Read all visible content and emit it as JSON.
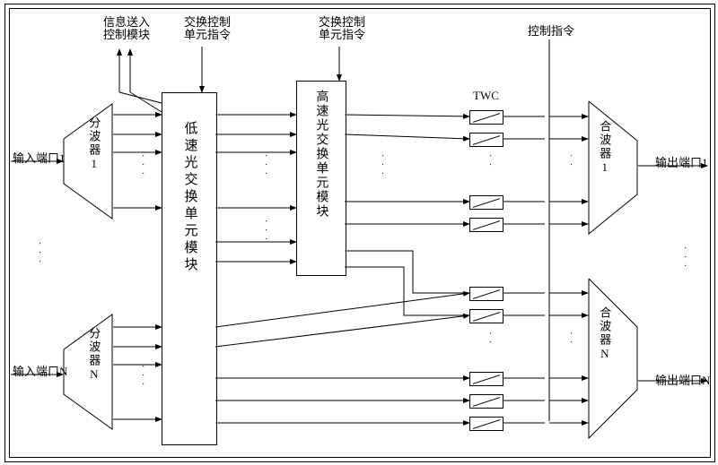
{
  "top_labels": {
    "info_send_ctrl": "信息送入\n控制模块",
    "exchange_ctrl_cmd_left": "交换控制\n单元指令",
    "exchange_ctrl_cmd_right": "交换控制\n单元指令",
    "ctrl_cmd": "控制指令"
  },
  "inputs": {
    "port1": "输入端口1",
    "portN": "输入端口N"
  },
  "outputs": {
    "port1": "输出端口1",
    "portN": "输出端口N"
  },
  "demux": {
    "d1": "分波器1",
    "dN": "分波器N"
  },
  "mux": {
    "m1": "合波器1",
    "mN": "合波器N"
  },
  "low_speed_unit": "低速光交换单元模块",
  "high_speed_unit": "高速光交换单元模块",
  "twc_label": "TWC",
  "chart_data": {
    "type": "diagram",
    "nodes": [
      {
        "id": "in1",
        "label": "输入端口1"
      },
      {
        "id": "inN",
        "label": "输入端口N"
      },
      {
        "id": "demux1",
        "label": "分波器1"
      },
      {
        "id": "demuxN",
        "label": "分波器N"
      },
      {
        "id": "low",
        "label": "低速光交换单元模块"
      },
      {
        "id": "high",
        "label": "高速光交换单元模块"
      },
      {
        "id": "twc_bank",
        "label": "TWC"
      },
      {
        "id": "mux1",
        "label": "合波器1"
      },
      {
        "id": "muxN",
        "label": "合波器N"
      },
      {
        "id": "out1",
        "label": "输出端口1"
      },
      {
        "id": "outN",
        "label": "输出端口N"
      },
      {
        "id": "info_ctrl",
        "label": "信息送入控制模块"
      },
      {
        "id": "ex_ctrl_low",
        "label": "交换控制单元指令"
      },
      {
        "id": "ex_ctrl_high",
        "label": "交换控制单元指令"
      },
      {
        "id": "ctrl_cmd",
        "label": "控制指令"
      }
    ],
    "edges": [
      {
        "from": "in1",
        "to": "demux1"
      },
      {
        "from": "inN",
        "to": "demuxN"
      },
      {
        "from": "demux1",
        "to": "low",
        "count": "multi"
      },
      {
        "from": "demuxN",
        "to": "low",
        "count": "multi"
      },
      {
        "from": "low",
        "to": "high",
        "count": "multi"
      },
      {
        "from": "low",
        "to": "twc_bank",
        "count": "multi",
        "note": "direct paths (low-speed bypass)"
      },
      {
        "from": "high",
        "to": "twc_bank",
        "count": "multi"
      },
      {
        "from": "twc_bank",
        "to": "mux1",
        "count": "multi"
      },
      {
        "from": "twc_bank",
        "to": "muxN",
        "count": "multi"
      },
      {
        "from": "mux1",
        "to": "out1"
      },
      {
        "from": "muxN",
        "to": "outN"
      },
      {
        "from": "low",
        "to": "info_ctrl",
        "dir": "up",
        "note": "control/info uplink"
      },
      {
        "from": "ex_ctrl_low",
        "to": "low",
        "dir": "down"
      },
      {
        "from": "ex_ctrl_high",
        "to": "high",
        "dir": "down"
      },
      {
        "from": "ctrl_cmd",
        "to": "twc_bank",
        "dir": "down"
      }
    ]
  }
}
